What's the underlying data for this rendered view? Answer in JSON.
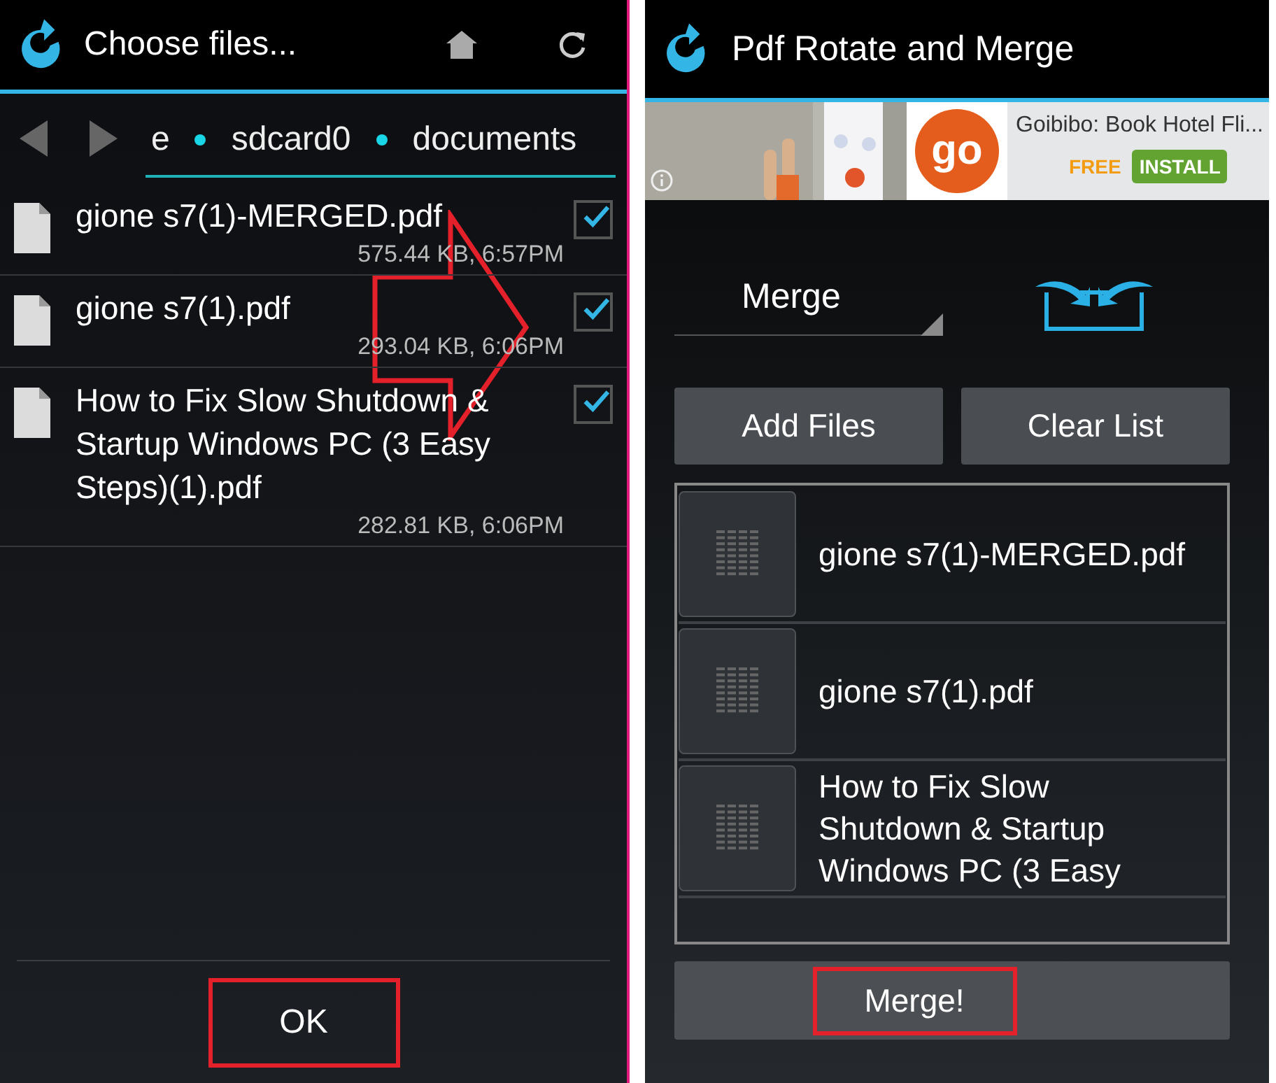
{
  "file_chooser": {
    "title": "Choose files...",
    "breadcrumb": [
      "e",
      "sdcard0",
      "documents"
    ],
    "files": [
      {
        "name": "gione s7(1)-MERGED.pdf",
        "info": "575.44 KB, 6:57PM",
        "checked": true
      },
      {
        "name": "gione s7(1).pdf",
        "info": "293.04 KB, 6:06PM",
        "checked": true
      },
      {
        "name": "How to Fix Slow Shutdown & Startup Windows PC (3 Easy Steps)(1).pdf",
        "info": "282.81 KB, 6:06PM",
        "checked": true
      }
    ],
    "ok_button": {
      "label": "OK",
      "highlighted": true
    }
  },
  "merge_app": {
    "title": "Pdf Rotate and Merge",
    "ad": {
      "logo_text": "go",
      "title": "Goibibo: Book Hotel Fli...",
      "price": "FREE",
      "install": "INSTALL"
    },
    "mode": "Merge",
    "buttons": [
      "Add Files",
      "Clear List"
    ],
    "files": [
      {
        "name": "gione s7(1)-MERGED.pdf"
      },
      {
        "name": "gione s7(1).pdf"
      },
      {
        "name": "How to Fix Slow Shutdown & Startup Windows PC (3 Easy"
      }
    ],
    "merge_button": {
      "label": "Merge!",
      "highlighted": true
    }
  }
}
